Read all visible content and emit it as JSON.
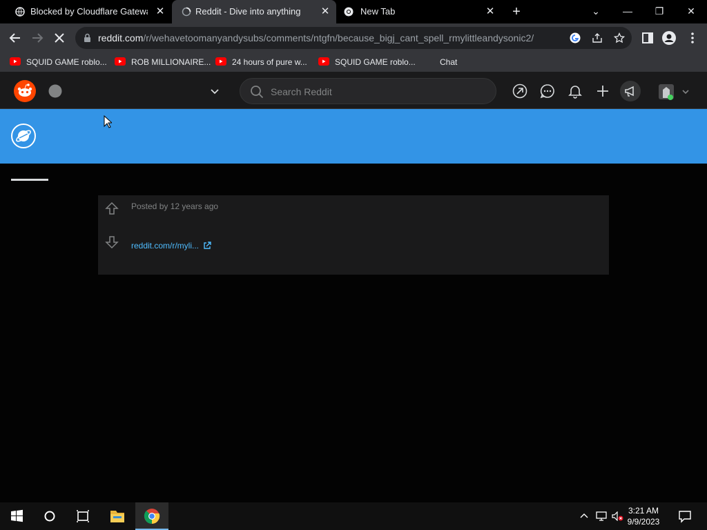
{
  "browser": {
    "tabs": [
      {
        "title": "Blocked by Cloudflare Gateway",
        "active": false
      },
      {
        "title": "Reddit - Dive into anything",
        "active": true
      },
      {
        "title": "New Tab",
        "active": false
      }
    ],
    "url_host": "reddit.com",
    "url_path": "/r/wehavetoomanyandysubs/comments/ntgfn/because_bigj_cant_spell_rmylittleandysonic2/",
    "bookmarks": [
      {
        "label": "SQUID GAME roblo...",
        "icon": "youtube-icon"
      },
      {
        "label": "ROB MILLIONAIRE...",
        "icon": "youtube-icon"
      },
      {
        "label": "24 hours of pure w...",
        "icon": "youtube-icon"
      },
      {
        "label": "SQUID GAME roblo...",
        "icon": "youtube-icon"
      },
      {
        "label": "Chat",
        "icon": ""
      }
    ]
  },
  "reddit": {
    "search_placeholder": "Search Reddit",
    "banner_color": "#3394e6",
    "post": {
      "posted_by": "Posted by 12 years ago",
      "link_text": "reddit.com/r/myli..."
    }
  },
  "taskbar": {
    "time": "3:21 AM",
    "date": "9/9/2023"
  },
  "colors": {
    "reddit_orange": "#ff4500",
    "link_blue": "#4fbcff",
    "page_bg": "#030303"
  }
}
